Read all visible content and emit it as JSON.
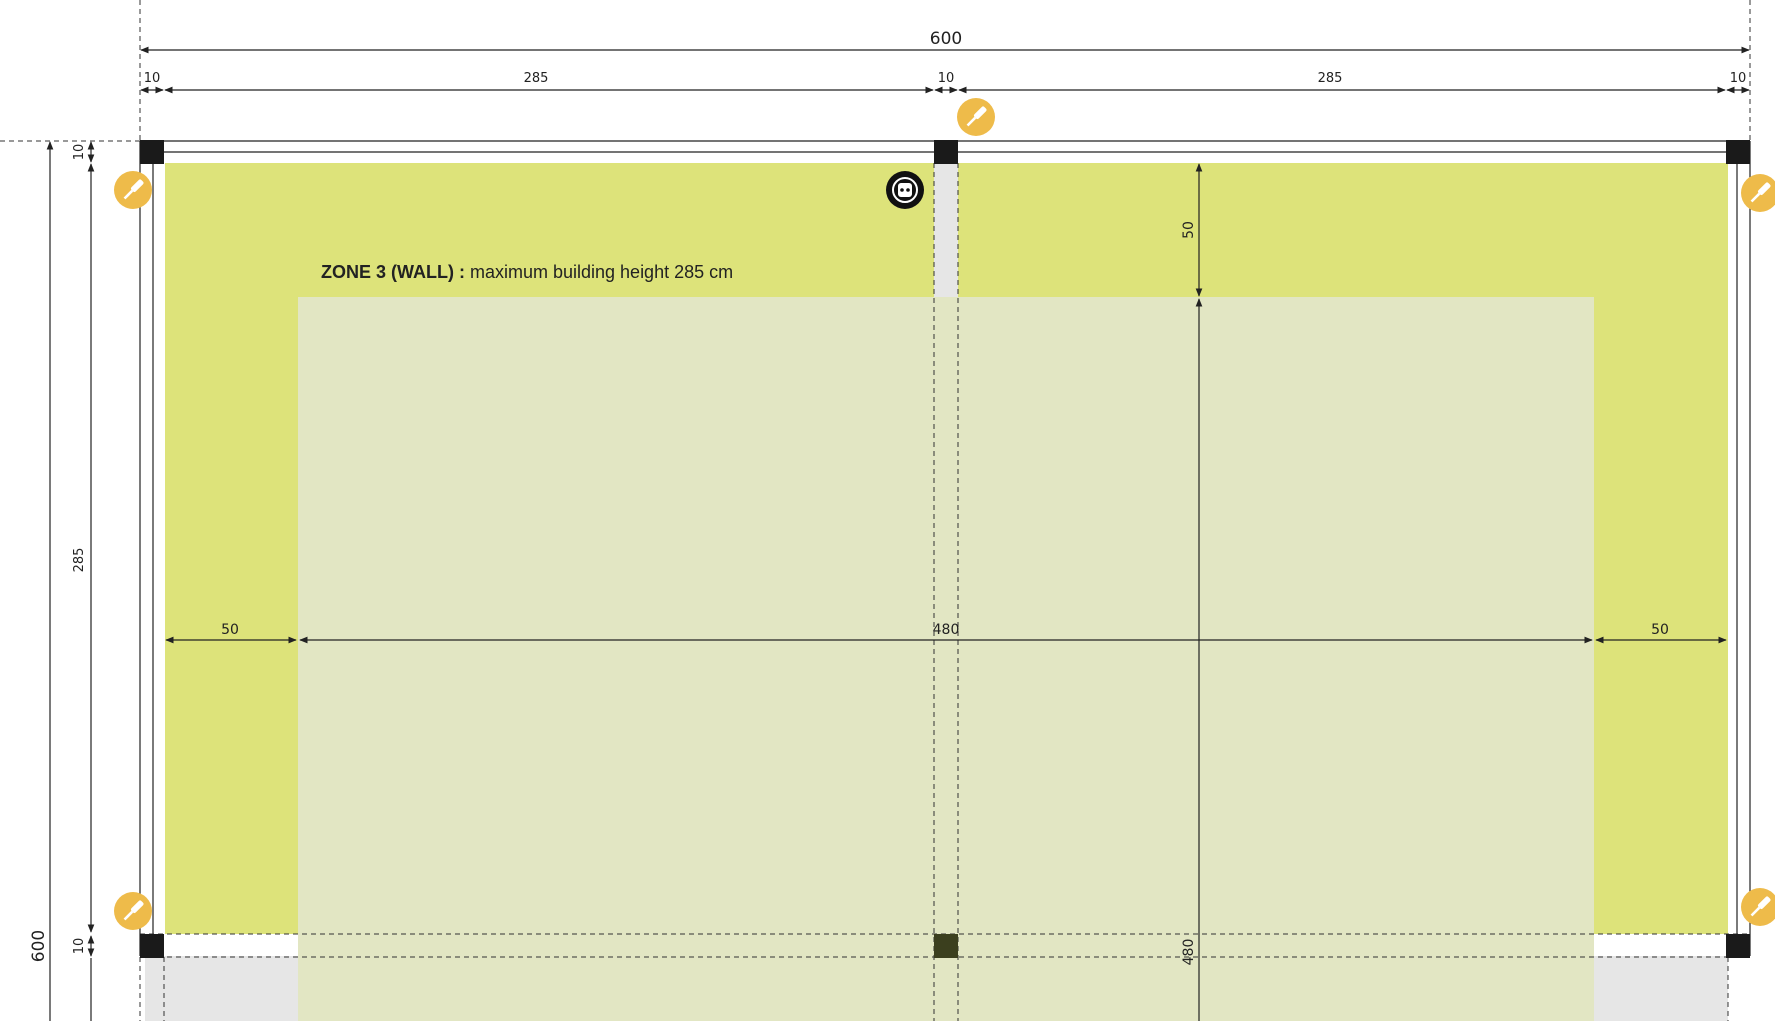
{
  "colors": {
    "zone_wall": "#dde37a",
    "zone_inner": "#e2e6c3",
    "ground": "#e6e6e6",
    "post": "#1a1a1a",
    "center_post": "#3b3f1e",
    "badge": "#eebb4a",
    "line": "#222222"
  },
  "zone": {
    "label_bold": "ZONE 3 (WALL) :",
    "label_text": " maximum building height 285 cm"
  },
  "dimensions": {
    "total_width": "600",
    "total_height": "600",
    "top_left_margin": "10",
    "top_left_span": "285",
    "top_mid_gap": "10",
    "top_right_span": "285",
    "top_right_margin": "10",
    "left_top_margin": "10",
    "left_span": "285",
    "left_bottom_margin": "10",
    "inner_depth": "50",
    "inner_left_band": "50",
    "inner_width": "480",
    "inner_right_band": "50",
    "inner_height": "480"
  },
  "icons": {
    "fixing_badge": "screwdriver-icon",
    "socket_badge": "power-socket-icon"
  }
}
